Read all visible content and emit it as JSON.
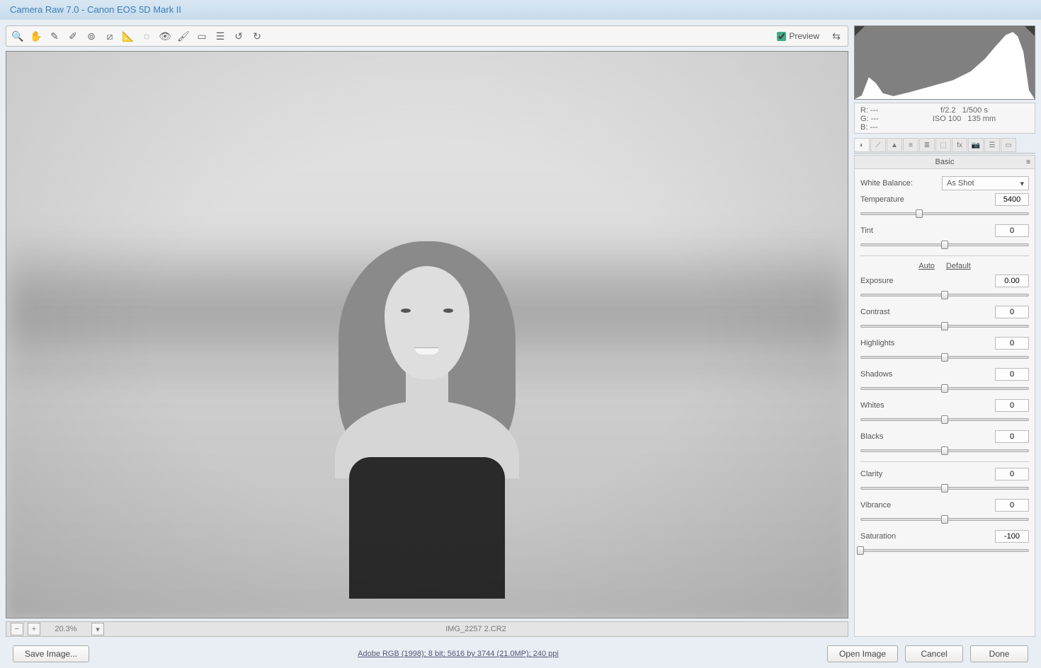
{
  "title": "Camera Raw 7.0  -  Canon EOS 5D Mark II",
  "toolbar": {
    "preview_label": "Preview",
    "preview_checked": true
  },
  "metadata": {
    "r": "R:    ---",
    "g": "G:    ---",
    "b": "B:    ---",
    "aperture": "f/2.2",
    "shutter": "1/500 s",
    "iso": "ISO 100",
    "focal": "135 mm"
  },
  "panel": {
    "title": "Basic",
    "wb_label": "White Balance:",
    "wb_value": "As Shot",
    "auto": "Auto",
    "default": "Default",
    "sliders": {
      "temperature": {
        "label": "Temperature",
        "value": "5400",
        "pos": 35
      },
      "tint": {
        "label": "Tint",
        "value": "0",
        "pos": 50
      },
      "exposure": {
        "label": "Exposure",
        "value": "0.00",
        "pos": 50
      },
      "contrast": {
        "label": "Contrast",
        "value": "0",
        "pos": 50
      },
      "highlights": {
        "label": "Highlights",
        "value": "0",
        "pos": 50
      },
      "shadows": {
        "label": "Shadows",
        "value": "0",
        "pos": 50
      },
      "whites": {
        "label": "Whites",
        "value": "0",
        "pos": 50
      },
      "blacks": {
        "label": "Blacks",
        "value": "0",
        "pos": 50
      },
      "clarity": {
        "label": "Clarity",
        "value": "0",
        "pos": 50
      },
      "vibrance": {
        "label": "Vibrance",
        "value": "0",
        "pos": 50
      },
      "saturation": {
        "label": "Saturation",
        "value": "-100",
        "pos": 0
      }
    }
  },
  "status": {
    "zoom": "20.3%",
    "filename": "IMG_2257 2.CR2"
  },
  "footer": {
    "save": "Save Image...",
    "workflow": "Adobe RGB (1998); 8 bit; 5616 by 3744 (21.0MP); 240 ppi",
    "open": "Open Image",
    "cancel": "Cancel",
    "done": "Done"
  }
}
